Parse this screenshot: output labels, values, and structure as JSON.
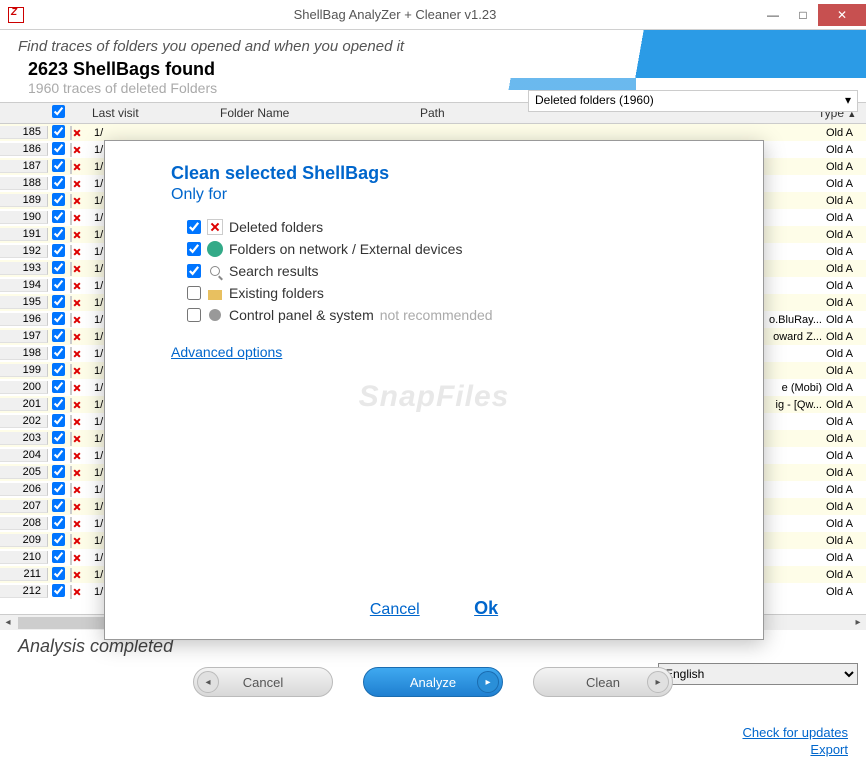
{
  "title": "ShellBag  AnalyZer + Cleaner v1.23",
  "tagline": "Find traces of folders you opened and when you opened it",
  "found_line": "2623 ShellBags found",
  "deleted_sub": "1960 traces of deleted Folders",
  "filter_text": "Deleted folders  (1960)",
  "columns": {
    "visit": "Last visit",
    "name": "Folder Name",
    "path": "Path",
    "type": "Type"
  },
  "status": "Analysis completed",
  "language": "English",
  "buttons": {
    "cancel": "Cancel",
    "analyze": "Analyze",
    "clean": "Clean"
  },
  "links": {
    "updates": "Check for updates",
    "export": "Export"
  },
  "dialog": {
    "title": "Clean selected ShellBags",
    "subtitle": "Only for",
    "opt_deleted": "Deleted folders",
    "opt_network": "Folders on network / External devices",
    "opt_search": "Search results",
    "opt_existing": "Existing folders",
    "opt_cp": "Control panel & system",
    "cp_note": "not recommended",
    "advanced": "Advanced options",
    "cancel": "Cancel",
    "ok": "Ok"
  },
  "watermark": "SnapFiles",
  "rows": [
    {
      "n": 185,
      "d": "1/",
      "t": "",
      "ty": "Old A"
    },
    {
      "n": 186,
      "d": "1/",
      "t": "",
      "ty": "Old A"
    },
    {
      "n": 187,
      "d": "1/",
      "t": "",
      "ty": "Old A"
    },
    {
      "n": 188,
      "d": "1/",
      "t": "",
      "ty": "Old A"
    },
    {
      "n": 189,
      "d": "1/",
      "t": "",
      "ty": "Old A"
    },
    {
      "n": 190,
      "d": "1/",
      "t": "",
      "ty": "Old A"
    },
    {
      "n": 191,
      "d": "1/",
      "t": "",
      "ty": "Old A"
    },
    {
      "n": 192,
      "d": "1/",
      "t": "",
      "ty": "Old A"
    },
    {
      "n": 193,
      "d": "1/",
      "t": "",
      "ty": "Old A"
    },
    {
      "n": 194,
      "d": "1/",
      "t": "",
      "ty": "Old A"
    },
    {
      "n": 195,
      "d": "1/",
      "t": "",
      "ty": "Old A"
    },
    {
      "n": 196,
      "d": "1/",
      "t": "o.BluRay...",
      "ty": "Old A"
    },
    {
      "n": 197,
      "d": "1/",
      "t": "oward Z...",
      "ty": "Old A"
    },
    {
      "n": 198,
      "d": "1/",
      "t": "",
      "ty": "Old A"
    },
    {
      "n": 199,
      "d": "1/",
      "t": "",
      "ty": "Old A"
    },
    {
      "n": 200,
      "d": "1/",
      "t": "e (Mobi)",
      "ty": "Old A"
    },
    {
      "n": 201,
      "d": "1/",
      "t": "ig - [Qw...",
      "ty": "Old A"
    },
    {
      "n": 202,
      "d": "1/",
      "t": "",
      "ty": "Old A"
    },
    {
      "n": 203,
      "d": "1/",
      "t": "",
      "ty": "Old A"
    },
    {
      "n": 204,
      "d": "1/",
      "t": "",
      "ty": "Old A"
    },
    {
      "n": 205,
      "d": "1/",
      "t": "",
      "ty": "Old A"
    },
    {
      "n": 206,
      "d": "1/",
      "t": "",
      "ty": "Old A"
    },
    {
      "n": 207,
      "d": "1/",
      "t": "",
      "ty": "Old A"
    },
    {
      "n": 208,
      "d": "1/",
      "t": "",
      "ty": "Old A"
    },
    {
      "n": 209,
      "d": "1/",
      "t": "",
      "ty": "Old A"
    },
    {
      "n": 210,
      "d": "1/",
      "t": "",
      "ty": "Old A"
    },
    {
      "n": 211,
      "d": "1/",
      "t": "",
      "ty": "Old A"
    },
    {
      "n": 212,
      "d": "1/",
      "t": "",
      "ty": "Old A"
    }
  ]
}
